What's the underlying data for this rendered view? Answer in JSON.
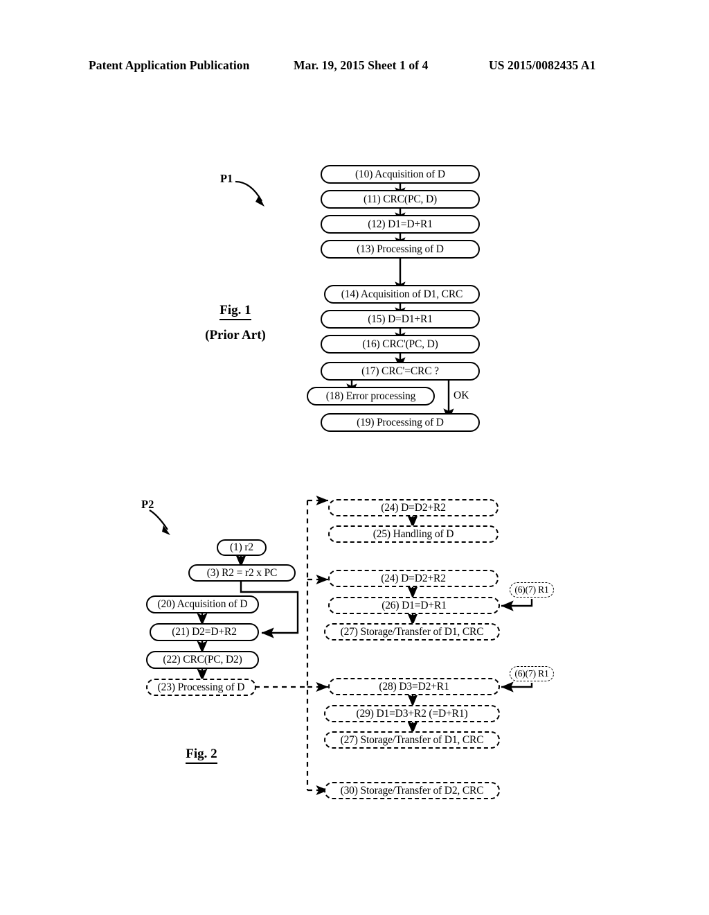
{
  "header": {
    "left": "Patent Application Publication",
    "center": "Mar. 19, 2015  Sheet 1 of 4",
    "right": "US 2015/0082435 A1"
  },
  "figure1": {
    "caption_title": "Fig. 1",
    "caption_sub": "(Prior Art)",
    "pointer_label": "P1",
    "branch_label": "OK",
    "nodes": [
      {
        "id": "n10",
        "text": "(10) Acquisition of D"
      },
      {
        "id": "n11",
        "text": "(11) CRC(PC, D)"
      },
      {
        "id": "n12",
        "text": "(12) D1=D+R1"
      },
      {
        "id": "n13",
        "text": "(13) Processing of D"
      },
      {
        "id": "n14",
        "text": "(14) Acquisition of D1, CRC"
      },
      {
        "id": "n15",
        "text": "(15) D=D1+R1"
      },
      {
        "id": "n16",
        "text": "(16) CRC'(PC, D)"
      },
      {
        "id": "n17",
        "text": "(17) CRC'=CRC ?"
      },
      {
        "id": "n18",
        "text": "(18) Error processing"
      },
      {
        "id": "n19",
        "text": "(19) Processing of D"
      }
    ]
  },
  "figure2": {
    "caption_title": "Fig. 2",
    "pointer_label": "P2",
    "nodes_left": [
      {
        "id": "n1",
        "text": "(1) r2"
      },
      {
        "id": "n3",
        "text": "(3) R2 = r2 x PC"
      },
      {
        "id": "n20",
        "text": "(20) Acquisition of D"
      },
      {
        "id": "n21",
        "text": "(21) D2=D+R2"
      },
      {
        "id": "n22",
        "text": "(22) CRC(PC, D2)"
      },
      {
        "id": "n23",
        "text": "(23) Processing of D"
      }
    ],
    "nodes_right": [
      {
        "id": "n24a",
        "text": "(24) D=D2+R2"
      },
      {
        "id": "n25",
        "text": "(25) Handling of D"
      },
      {
        "id": "n24b",
        "text": "(24) D=D2+R2"
      },
      {
        "id": "n26",
        "text": "(26) D1=D+R1"
      },
      {
        "id": "n27a",
        "text": "(27) Storage/Transfer of D1, CRC"
      },
      {
        "id": "n28",
        "text": "(28) D3=D2+R1"
      },
      {
        "id": "n29",
        "text": "(29) D1=D3+R2 (=D+R1)"
      },
      {
        "id": "n27b",
        "text": "(27) Storage/Transfer of D1, CRC"
      },
      {
        "id": "n30",
        "text": "(30) Storage/Transfer of D2, CRC"
      }
    ],
    "side_nodes": [
      {
        "id": "r1a",
        "text": "(6)(7) R1"
      },
      {
        "id": "r1b",
        "text": "(6)(7) R1"
      }
    ]
  }
}
